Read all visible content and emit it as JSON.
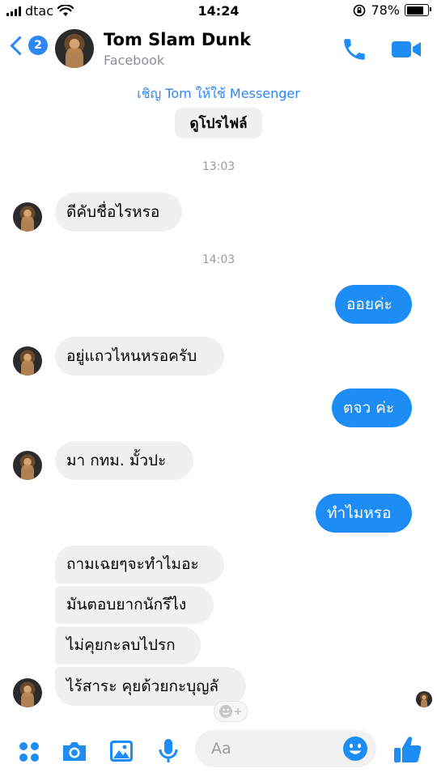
{
  "status_bar": {
    "carrier": "dtac",
    "time": "14:24",
    "battery": "78%"
  },
  "header": {
    "badge_count": "2",
    "contact_name": "Tom Slam Dunk",
    "contact_subtitle": "Facebook"
  },
  "invite": {
    "text": "เชิญ Tom ให้ใช้ Messenger",
    "profile_button": "ดูโปรไฟล์"
  },
  "timestamps": [
    "13:03",
    "14:03"
  ],
  "messages": [
    {
      "side": "in",
      "text": "ดีคับชื่อไรหรอ"
    },
    {
      "side": "out",
      "text": "ออยค่ะ"
    },
    {
      "side": "in",
      "text": "อยู่แถวไหนหรอครับ"
    },
    {
      "side": "out",
      "text": "ตจว ค่ะ"
    },
    {
      "side": "in",
      "text": "มา  กทม. มั้วปะ"
    },
    {
      "side": "out",
      "text": "ทำไมหรอ"
    },
    {
      "side": "in",
      "text": "ถามเฉยๆจะทำไมอะ"
    },
    {
      "side": "in",
      "text": "มันตอบยากนักรึไง"
    },
    {
      "side": "in",
      "text": "ไม่คุยกะลบไปรก"
    },
    {
      "side": "in",
      "text": "ไร้สาระ คุยด้วยกะบุญลั"
    }
  ],
  "composer": {
    "placeholder": "Aa"
  },
  "colors": {
    "accent": "#2f87f7",
    "outgoing_bubble": "#1e8cf5",
    "incoming_bubble": "#f1f0f0"
  }
}
